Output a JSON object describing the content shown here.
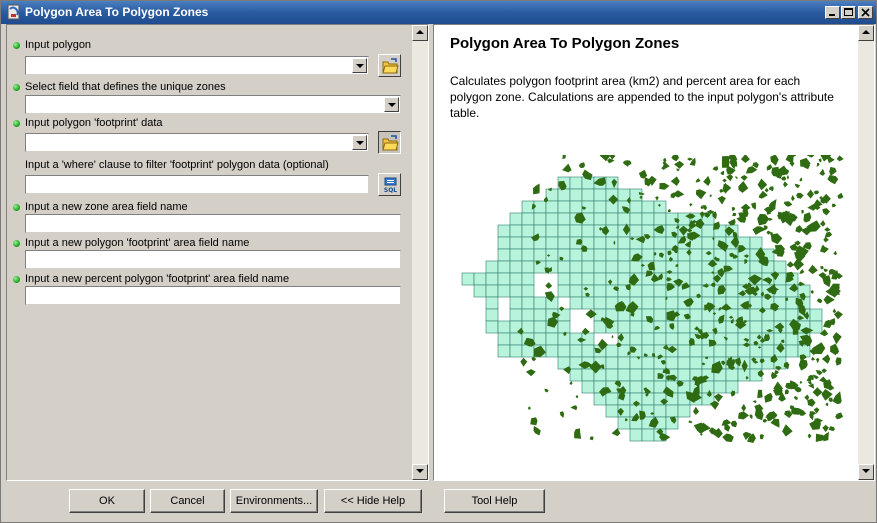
{
  "window": {
    "title": "Polygon Area To Polygon Zones",
    "icon": "toolbox-icon",
    "controls": [
      "minimize-icon",
      "maximize-icon",
      "close-icon"
    ]
  },
  "params": {
    "input_polygon": {
      "label": "Input polygon",
      "value": "",
      "required": true
    },
    "zone_field": {
      "label": "Select field that defines the unique zones",
      "value": "",
      "required": true
    },
    "footprint_data": {
      "label": "Input polygon 'footprint' data",
      "value": "",
      "required": true
    },
    "where_clause": {
      "label": "Input a 'where' clause to filter 'footprint' polygon data (optional)",
      "value": "",
      "required": false,
      "sql_label": "SQL"
    },
    "zone_area_field": {
      "label": "Input a new zone area field name",
      "value": "",
      "required": true
    },
    "footprint_area_field": {
      "label": "Input a new polygon 'footprint' area field name",
      "value": "",
      "required": true
    },
    "percent_area_field": {
      "label": "Input a new percent polygon 'footprint' area field name",
      "value": "",
      "required": true
    }
  },
  "help": {
    "title": "Polygon Area To Polygon Zones",
    "description": "Calculates polygon footprint area (km2) and percent area for each polygon zone. Calculations are appended to the input polygon's attribute table."
  },
  "buttons": {
    "ok": "OK",
    "cancel": "Cancel",
    "environments": "Environments...",
    "hide_help": "<< Hide Help",
    "tool_help": "Tool Help"
  },
  "colors": {
    "grid_fill": "#b8f3dc",
    "grid_stroke": "#2f7d6a",
    "footprint": "#2f6b12",
    "required_bullet": "#1ea81e"
  }
}
